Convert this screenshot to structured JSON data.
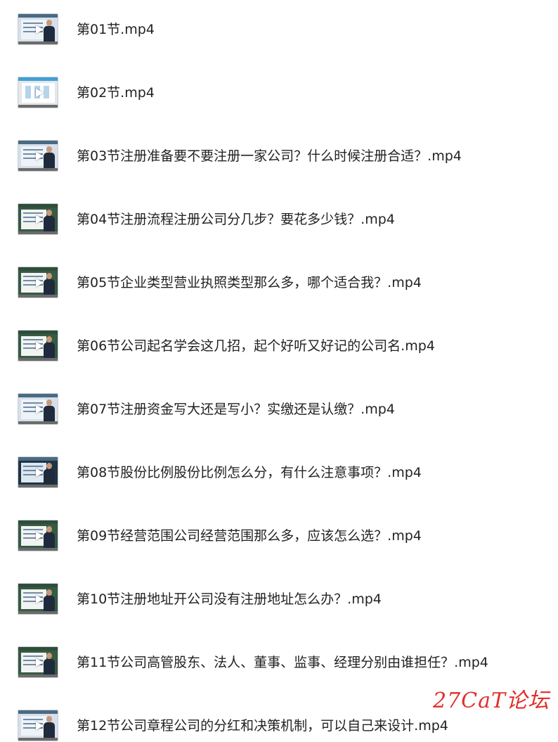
{
  "files": [
    {
      "name": "第01节.mp4",
      "thumb": "video-thumbnail",
      "style": "v-blue"
    },
    {
      "name": "第02节.mp4",
      "thumb": "video-thumbnail",
      "style": "v-light"
    },
    {
      "name": "第03节注册准备要不要注册一家公司？什么时候注册合适？.mp4",
      "thumb": "video-thumbnail",
      "style": "v-blue"
    },
    {
      "name": "第04节注册流程注册公司分几步？要花多少钱？.mp4",
      "thumb": "video-thumbnail",
      "style": "v-green"
    },
    {
      "name": "第05节企业类型营业执照类型那么多，哪个适合我？.mp4",
      "thumb": "video-thumbnail",
      "style": "v-green"
    },
    {
      "name": "第06节公司起名学会这几招，起个好听又好记的公司名.mp4",
      "thumb": "video-thumbnail",
      "style": "v-green"
    },
    {
      "name": "第07节注册资金写大还是写小？实缴还是认缴？.mp4",
      "thumb": "video-thumbnail",
      "style": "v-blue"
    },
    {
      "name": "第08节股份比例股份比例怎么分，有什么注意事项？.mp4",
      "thumb": "video-thumbnail",
      "style": "v-dark"
    },
    {
      "name": "第09节经营范围公司经营范围那么多，应该怎么选？.mp4",
      "thumb": "video-thumbnail",
      "style": "v-green"
    },
    {
      "name": "第10节注册地址开公司没有注册地址怎么办？.mp4",
      "thumb": "video-thumbnail",
      "style": "v-green"
    },
    {
      "name": "第11节公司高管股东、法人、董事、监事、经理分别由谁担任？.mp4",
      "thumb": "video-thumbnail",
      "style": "v-green"
    },
    {
      "name": "第12节公司章程公司的分红和决策机制，可以自己来设计.mp4",
      "thumb": "video-thumbnail",
      "style": "v-blue"
    }
  ],
  "watermark": "27CaT论坛",
  "colors": {
    "text": "#222222",
    "watermark": "#e0302a",
    "background": "#ffffff"
  },
  "icons": {
    "play": "play-icon"
  }
}
